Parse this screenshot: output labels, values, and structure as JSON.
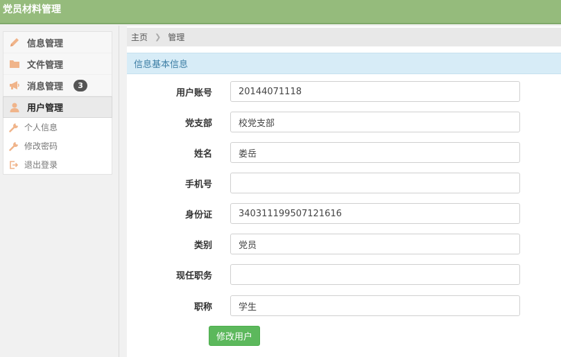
{
  "app": {
    "title": "党员材料管理"
  },
  "sidebar": {
    "items": [
      {
        "label": "信息管理",
        "icon": "pencil-icon"
      },
      {
        "label": "文件管理",
        "icon": "folder-icon"
      },
      {
        "label": "消息管理",
        "icon": "megaphone-icon",
        "badge": "3"
      },
      {
        "label": "用户管理",
        "icon": "user-icon",
        "active": true
      }
    ],
    "subitems": [
      {
        "label": "个人信息",
        "icon": "wrench-icon"
      },
      {
        "label": "修改密码",
        "icon": "wrench-icon"
      },
      {
        "label": "退出登录",
        "icon": "logout-icon"
      }
    ]
  },
  "breadcrumb": {
    "home": "主页",
    "current": "管理"
  },
  "panel": {
    "title": "信息基本信息"
  },
  "form": {
    "fields": [
      {
        "label": "用户账号",
        "value": "20144071118"
      },
      {
        "label": "党支部",
        "value": "校党支部"
      },
      {
        "label": "姓名",
        "value": "娄岳"
      },
      {
        "label": "手机号",
        "value": ""
      },
      {
        "label": "身份证",
        "value": "340311199507121616"
      },
      {
        "label": "类别",
        "value": "党员"
      },
      {
        "label": "现任职务",
        "value": ""
      },
      {
        "label": "职称",
        "value": "学生"
      }
    ],
    "submit_label": "修改用户"
  },
  "colors": {
    "header": "#95bb7c",
    "icon_accent": "#f0b48a",
    "panel_head": "#d7ecf7",
    "submit": "#5cb85c"
  }
}
